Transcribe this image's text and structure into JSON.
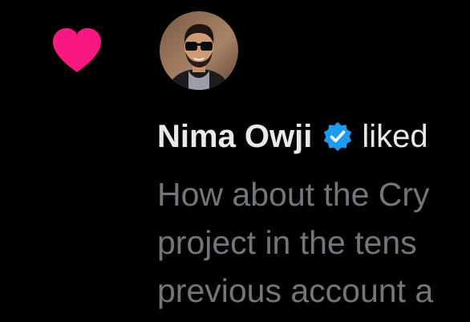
{
  "notification": {
    "type_icon": "heart-icon",
    "type_color": "#f91880",
    "avatar_icon": "user-avatar",
    "user_name": "Nima Owji",
    "verified_icon": "verified-badge-icon",
    "verified_color": "#1d9bf0",
    "action_text": "liked",
    "tweet_preview_lines": [
      "How about the Cry",
      "project in the tens",
      "previous account a"
    ]
  },
  "theme": {
    "background": "#000000",
    "primary_text": "#e7e9ea",
    "secondary_text": "#71767b"
  }
}
